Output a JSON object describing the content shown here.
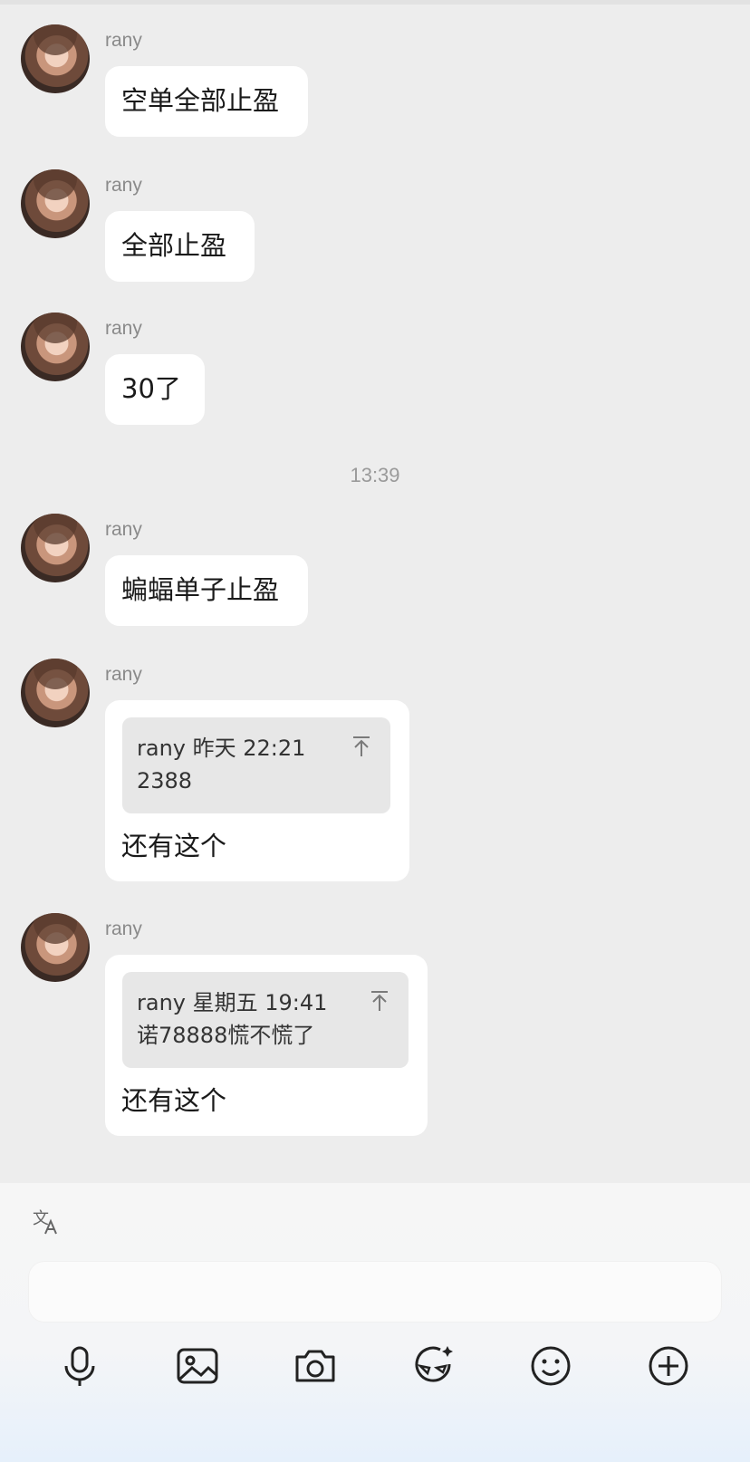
{
  "messages": [
    {
      "sender": "rany",
      "text": "空单全部止盈"
    },
    {
      "sender": "rany",
      "text": "全部止盈"
    },
    {
      "sender": "rany",
      "text": "30了"
    },
    {
      "sender": "rany",
      "text": "蝙蝠单子止盈"
    },
    {
      "sender": "rany",
      "quote": {
        "header": "rany 昨天 22:21",
        "body": "2388"
      },
      "text": "还有这个"
    },
    {
      "sender": "rany",
      "quote": {
        "header": "rany 星期五 19:41",
        "body": "诺78888慌不慌了"
      },
      "text": "还有这个"
    }
  ],
  "timestamp": "13:39",
  "toolbar": {
    "icons": [
      "translate-icon",
      "microphone-icon",
      "image-icon",
      "camera-icon",
      "sticker-icon",
      "emoji-icon",
      "plus-icon"
    ]
  },
  "colors": {
    "background": "#ededed",
    "bubble": "#ffffff",
    "quote": "#e7e7e7"
  }
}
